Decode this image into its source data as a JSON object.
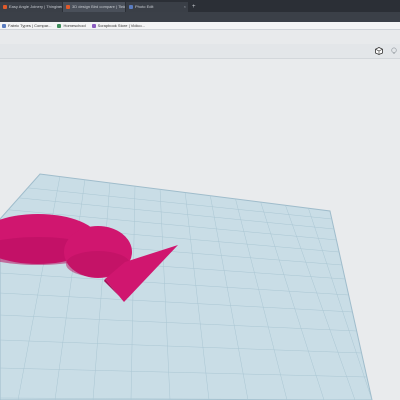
{
  "browser": {
    "tabs": [
      {
        "label": "Easy Angle Joinery | Thingiverse.com"
      },
      {
        "label": "3D design Bird compare | Tinkercad"
      },
      {
        "label": "Photo Edit"
      }
    ],
    "new_tab_label": "+",
    "bookmarks": [
      {
        "label": "Fabric Types | Compar..."
      },
      {
        "label": "Homeschool"
      },
      {
        "label": "Scrapbook Store | Vidico..."
      }
    ]
  },
  "app": {
    "toolbar_icons": [
      "view-cube-icon",
      "lightbulb-icon"
    ]
  },
  "scene": {
    "workplane_color": "#c9dde6",
    "grid_color": "#9fbccb",
    "shape_color": "#d0166f"
  }
}
